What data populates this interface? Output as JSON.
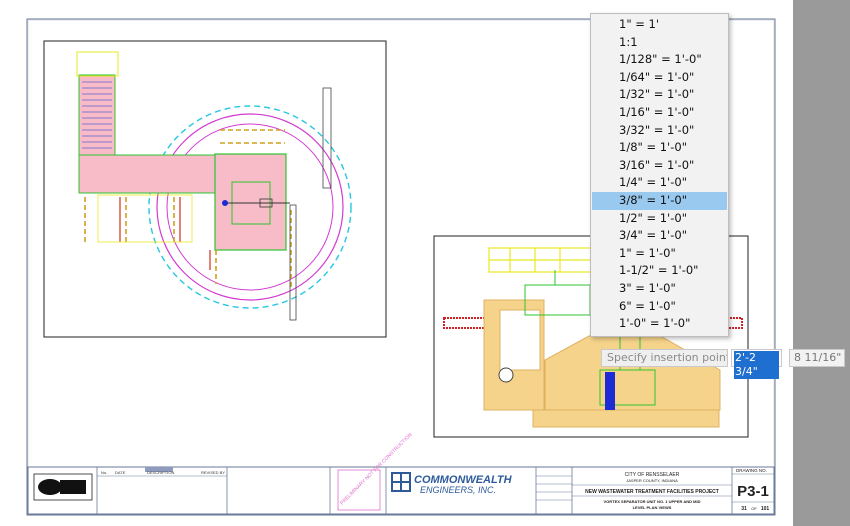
{
  "scale_menu": {
    "items": [
      {
        "label": "1\" = 1'",
        "selected": false
      },
      {
        "label": "1:1",
        "selected": false
      },
      {
        "label": "1/128\" = 1'-0\"",
        "selected": false
      },
      {
        "label": "1/64\" = 1'-0\"",
        "selected": false
      },
      {
        "label": "1/32\" = 1'-0\"",
        "selected": false
      },
      {
        "label": "1/16\" = 1'-0\"",
        "selected": false
      },
      {
        "label": "3/32\" = 1'-0\"",
        "selected": false
      },
      {
        "label": "1/8\" = 1'-0\"",
        "selected": false
      },
      {
        "label": "3/16\" = 1'-0\"",
        "selected": false
      },
      {
        "label": "1/4\" = 1'-0\"",
        "selected": false
      },
      {
        "label": "3/8\" = 1'-0\"",
        "selected": true
      },
      {
        "label": "1/2\" = 1'-0\"",
        "selected": false
      },
      {
        "label": "3/4\" = 1'-0\"",
        "selected": false
      },
      {
        "label": "1\" = 1'-0\"",
        "selected": false
      },
      {
        "label": "1-1/2\" = 1'-0\"",
        "selected": false
      },
      {
        "label": "3\" = 1'-0\"",
        "selected": false
      },
      {
        "label": "6\" = 1'-0\"",
        "selected": false
      },
      {
        "label": "1'-0\" = 1'-0\"",
        "selected": false
      }
    ]
  },
  "command_prompt": {
    "label": "Specify insertion point:",
    "x_value": "2'-2 3/4\"",
    "y_value": "8 11/16\""
  },
  "title_block": {
    "company": "COMMONWEALTH",
    "company_sub": "ENGINEERS, INC.",
    "city": "CITY OF RENSSELAER",
    "county": "JASPER COUNTY, INDIANA",
    "project": "NEW WASTEWATER TREATMENT FACILITIES PROJECT",
    "sheet_title_1": "VORTEX SEPARATOR UNIT NO. 1 UPPER AND MID",
    "sheet_title_2": "LEVEL PLAN VIEWS",
    "drawing_no_label": "DRAWING NO.",
    "drawing_no": "P3-1",
    "sheet_num": "31",
    "of_label": "OF",
    "sheet_total": "101",
    "stamp_text": "PRELIMINARY NOT FOR CONSTRUCTION",
    "rev_headers": [
      "No.",
      "DATE",
      "DESCRIPTION",
      "REVISED BY"
    ]
  },
  "colors": {
    "menu_selected": "#99c9ef",
    "input_highlight": "#1e6fd0"
  }
}
